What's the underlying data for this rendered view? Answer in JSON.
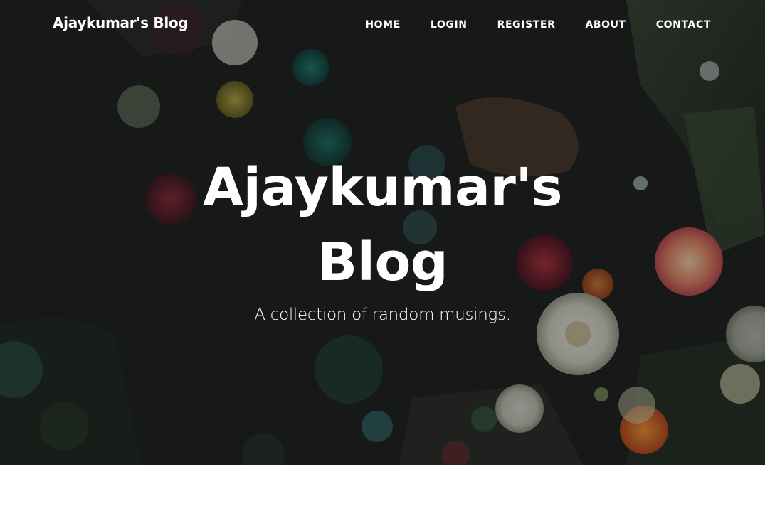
{
  "navbar": {
    "brand": "Ajaykumar's Blog",
    "links": [
      {
        "label": "HOME"
      },
      {
        "label": "LOGIN"
      },
      {
        "label": "REGISTER"
      },
      {
        "label": "ABOUT"
      },
      {
        "label": "CONTACT"
      }
    ]
  },
  "header": {
    "title": "Ajaykumar's Blog",
    "subtitle": "A collection of random musings."
  },
  "colors": {
    "text": "#ffffff",
    "overlay": "#1a1d1b",
    "page_bg": "#ffffff"
  }
}
